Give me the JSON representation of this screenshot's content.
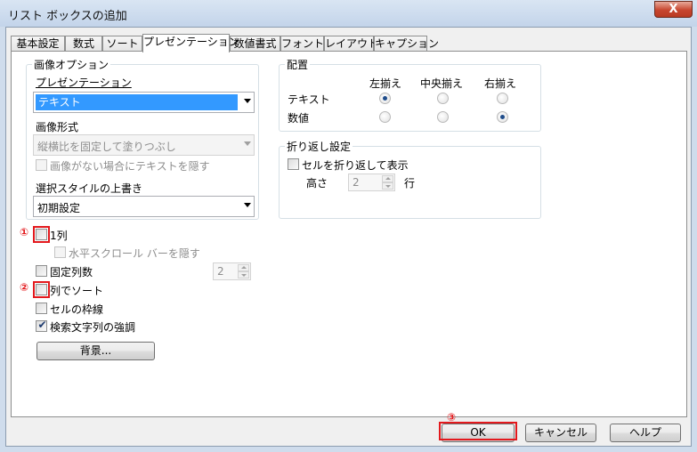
{
  "window": {
    "title": "リスト ボックスの追加",
    "close_symbol": "X"
  },
  "tabs": [
    {
      "label": "基本設定",
      "active": false
    },
    {
      "label": "数式",
      "active": false
    },
    {
      "label": "ソート",
      "active": false
    },
    {
      "label": "プレゼンテーション",
      "active": true
    },
    {
      "label": "数値書式",
      "active": false
    },
    {
      "label": "フォント",
      "active": false
    },
    {
      "label": "レイアウト",
      "active": false
    },
    {
      "label": "キャプション",
      "active": false
    }
  ],
  "image_options": {
    "group_title": "画像オプション",
    "presentation_label": "プレゼンテーション",
    "presentation_value": "テキスト",
    "format_label": "画像形式",
    "format_value": "縦横比を固定して塗りつぶし",
    "hide_text_label": "画像がない場合にテキストを隠す",
    "hide_text_checked": false
  },
  "selection_style": {
    "label": "選択スタイルの上書き",
    "value": "初期設定"
  },
  "alignment": {
    "group_title": "配置",
    "columns": [
      "左揃え",
      "中央揃え",
      "右揃え"
    ],
    "rows": [
      {
        "label": "テキスト",
        "selected": "左揃え"
      },
      {
        "label": "数値",
        "selected": "右揃え"
      }
    ]
  },
  "wrap": {
    "group_title": "折り返し設定",
    "wrap_label": "セルを折り返して表示",
    "wrap_checked": false,
    "height_label": "高さ",
    "height_value": "2",
    "unit_label": "行"
  },
  "options": {
    "single_column_label": "1列",
    "single_column_checked": false,
    "hide_scrollbar_label": "水平スクロール バーを隠す",
    "hide_scrollbar_checked": false,
    "fixed_columns_label": "固定列数",
    "fixed_columns_checked": false,
    "fixed_columns_value": "2",
    "sort_by_column_label": "列でソート",
    "sort_by_column_checked": false,
    "cell_borders_label": "セルの枠線",
    "cell_borders_checked": false,
    "highlight_search_label": "検索文字列の強調",
    "highlight_search_checked": true,
    "background_button": "背景..."
  },
  "annotations": {
    "marker_1": "①",
    "marker_2": "②",
    "marker_3": "③",
    "color": "#e3191d"
  },
  "footer": {
    "ok_label": "OK",
    "cancel_label": "キャンセル",
    "help_label": "ヘルプ"
  }
}
